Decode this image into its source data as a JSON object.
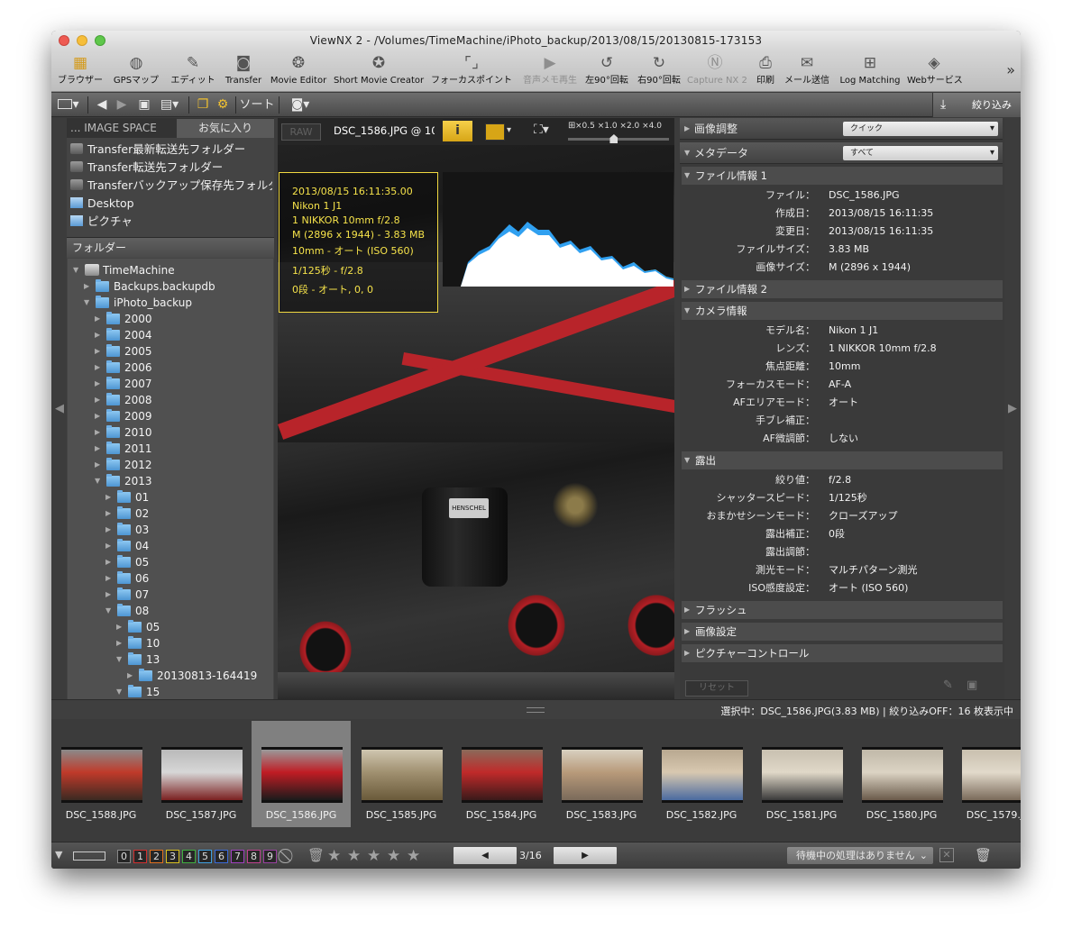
{
  "window": {
    "title": "ViewNX 2 - /Volumes/TimeMachine/iPhoto_backup/2013/08/15/20130815-173153"
  },
  "toolbar": {
    "items": [
      {
        "label": "ブラウザー",
        "icon": "browser-icon"
      },
      {
        "label": "GPSマップ",
        "icon": "globe-icon"
      },
      {
        "label": "エディット",
        "icon": "edit-icon"
      },
      {
        "label": "Transfer",
        "icon": "camera-icon"
      },
      {
        "label": "Movie Editor",
        "icon": "film-reel-icon"
      },
      {
        "label": "Short Movie Creator",
        "icon": "movie-creator-icon"
      },
      {
        "label": "フォーカスポイント",
        "icon": "focus-point-icon"
      },
      {
        "label": "音声メモ再生",
        "icon": "play-icon"
      },
      {
        "label": "左90°回転",
        "icon": "rotate-left-icon"
      },
      {
        "label": "右90°回転",
        "icon": "rotate-right-icon"
      },
      {
        "label": "Capture NX 2",
        "icon": "capture-nx-icon"
      },
      {
        "label": "印刷",
        "icon": "print-icon"
      },
      {
        "label": "メール送信",
        "icon": "mail-icon"
      },
      {
        "label": "Log Matching",
        "icon": "log-matching-icon"
      },
      {
        "label": "Webサービス",
        "icon": "web-service-icon"
      }
    ],
    "more": "»"
  },
  "toolbar2": {
    "sort_label": "ソート",
    "filter_label": "絞り込み"
  },
  "left_panel": {
    "tab_image_space": "... IMAGE SPACE",
    "tab_favorites": "お気に入り",
    "favorites": [
      "Transfer最新転送先フォルダー",
      "Transfer転送先フォルダー",
      "Transferバックアップ保存先フォルダー",
      "Desktop",
      "ピクチャ"
    ],
    "folder_header": "フォルダー",
    "tree": [
      {
        "label": "TimeMachine",
        "level": 0,
        "open": true,
        "drive": true
      },
      {
        "label": "Backups.backupdb",
        "level": 1,
        "open": false
      },
      {
        "label": "iPhoto_backup",
        "level": 1,
        "open": true
      },
      {
        "label": "2000",
        "level": 2,
        "open": false
      },
      {
        "label": "2004",
        "level": 2,
        "open": false
      },
      {
        "label": "2005",
        "level": 2,
        "open": false
      },
      {
        "label": "2006",
        "level": 2,
        "open": false
      },
      {
        "label": "2007",
        "level": 2,
        "open": false
      },
      {
        "label": "2008",
        "level": 2,
        "open": false
      },
      {
        "label": "2009",
        "level": 2,
        "open": false
      },
      {
        "label": "2010",
        "level": 2,
        "open": false
      },
      {
        "label": "2011",
        "level": 2,
        "open": false
      },
      {
        "label": "2012",
        "level": 2,
        "open": false
      },
      {
        "label": "2013",
        "level": 2,
        "open": true
      },
      {
        "label": "01",
        "level": 3,
        "open": false
      },
      {
        "label": "02",
        "level": 3,
        "open": false
      },
      {
        "label": "03",
        "level": 3,
        "open": false
      },
      {
        "label": "04",
        "level": 3,
        "open": false
      },
      {
        "label": "05",
        "level": 3,
        "open": false
      },
      {
        "label": "06",
        "level": 3,
        "open": false
      },
      {
        "label": "07",
        "level": 3,
        "open": false
      },
      {
        "label": "08",
        "level": 3,
        "open": true
      },
      {
        "label": "05",
        "level": 4,
        "open": false
      },
      {
        "label": "10",
        "level": 4,
        "open": false
      },
      {
        "label": "13",
        "level": 4,
        "open": true
      },
      {
        "label": "20130813-164419",
        "level": 5,
        "open": false
      },
      {
        "label": "15",
        "level": 4,
        "open": true
      }
    ]
  },
  "viewer": {
    "raw_label": "RAW",
    "file_zoom": "DSC_1586.JPG @ 10",
    "info_label": "i",
    "zoom_options": "×0.5  ×1.0  ×2.0  ×4.0",
    "zoom_level": 0.45,
    "info_overlay": [
      "2013/08/15 16:11:35.00",
      "Nikon 1 J1",
      "1 NIKKOR 10mm f/2.8",
      "M (2896 x 1944) - 3.83 MB",
      "10mm - オート (ISO 560)",
      "1/125秒 - f/2.8",
      "0段 - オート, 0, 0"
    ],
    "photo_plate_text": "HENSCHEL"
  },
  "right_panel": {
    "adjust_label": "画像調整",
    "adjust_value": "クイック",
    "metadata_label": "メタデータ",
    "metadata_value": "すべて",
    "sections": [
      {
        "title": "ファイル情報 1",
        "open": true,
        "rows": [
          {
            "k": "ファイル：",
            "v": "DSC_1586.JPG"
          },
          {
            "k": "作成日：",
            "v": "2013/08/15 16:11:35"
          },
          {
            "k": "変更日：",
            "v": "2013/08/15 16:11:35"
          },
          {
            "k": "ファイルサイズ：",
            "v": "3.83 MB"
          },
          {
            "k": "画像サイズ：",
            "v": "M (2896 x 1944)"
          }
        ]
      },
      {
        "title": "ファイル情報 2",
        "open": false,
        "rows": []
      },
      {
        "title": "カメラ情報",
        "open": true,
        "rows": [
          {
            "k": "モデル名：",
            "v": "Nikon 1 J1"
          },
          {
            "k": "レンズ：",
            "v": "1 NIKKOR 10mm f/2.8"
          },
          {
            "k": "焦点距離：",
            "v": "10mm"
          },
          {
            "k": "フォーカスモード：",
            "v": "AF-A"
          },
          {
            "k": "AFエリアモード：",
            "v": "オート"
          },
          {
            "k": "手ブレ補正：",
            "v": ""
          },
          {
            "k": "AF微調節：",
            "v": "しない"
          }
        ]
      },
      {
        "title": "露出",
        "open": true,
        "rows": [
          {
            "k": "絞り値：",
            "v": "f/2.8"
          },
          {
            "k": "シャッタースピード：",
            "v": "1/125秒"
          },
          {
            "k": "おまかせシーンモード：",
            "v": "クローズアップ"
          },
          {
            "k": "露出補正：",
            "v": "0段"
          },
          {
            "k": "露出調節：",
            "v": ""
          },
          {
            "k": "測光モード：",
            "v": "マルチパターン測光"
          },
          {
            "k": "ISO感度設定：",
            "v": "オート (ISO 560)"
          }
        ]
      },
      {
        "title": "フラッシュ",
        "open": false,
        "rows": []
      },
      {
        "title": "画像設定",
        "open": false,
        "rows": []
      },
      {
        "title": "ピクチャーコントロール",
        "open": false,
        "rows": []
      }
    ],
    "reset_label": "リセット"
  },
  "status": {
    "text": "選択中：DSC_1586.JPG(3.83 MB) | 絞り込みOFF：16 枚表示中"
  },
  "filmstrip": {
    "thumbs": [
      {
        "name": "DSC_1588.JPG",
        "c1": "#8a8a8a",
        "c2": "#3b2a22",
        "c3": "#c03a2a"
      },
      {
        "name": "DSC_1587.JPG",
        "c1": "#b9b9b9",
        "c2": "#7a2020",
        "c3": "#d7d7d7"
      },
      {
        "name": "DSC_1586.JPG",
        "c1": "#9a9a9a",
        "c2": "#1b1b1b",
        "c3": "#c01c24",
        "selected": true
      },
      {
        "name": "DSC_1585.JPG",
        "c1": "#cfc6b0",
        "c2": "#6a5a3a",
        "c3": "#a09070"
      },
      {
        "name": "DSC_1584.JPG",
        "c1": "#8a6a5a",
        "c2": "#3a1a1a",
        "c3": "#c02a2a"
      },
      {
        "name": "DSC_1583.JPG",
        "c1": "#d8d0c0",
        "c2": "#7a6a5a",
        "c3": "#b89a7a"
      },
      {
        "name": "DSC_1582.JPG",
        "c1": "#b8a890",
        "c2": "#4a6aa0",
        "c3": "#d8c8b0"
      },
      {
        "name": "DSC_1581.JPG",
        "c1": "#c8c0b0",
        "c2": "#3a3a3a",
        "c3": "#e0d8c8"
      },
      {
        "name": "DSC_1580.JPG",
        "c1": "#c0b8a8",
        "c2": "#6a5a4a",
        "c3": "#dcd4c4"
      },
      {
        "name": "DSC_1579.JPG",
        "c1": "#c8bfae",
        "c2": "#7a6a5a",
        "c3": "#e2dacb"
      }
    ]
  },
  "bottombar": {
    "labels": [
      "0",
      "1",
      "2",
      "3",
      "4",
      "5",
      "6",
      "7",
      "8",
      "9"
    ],
    "label_colors": [
      "#888888",
      "#d03030",
      "#e07020",
      "#d8c020",
      "#40b040",
      "#40a0e0",
      "#3a6ad8",
      "#a040c0",
      "#c04090",
      "#9a40a0"
    ],
    "stars": [
      "★",
      "★",
      "★",
      "★",
      "★"
    ],
    "page_indicator": "3/16",
    "queue_text": "待機中の処理はありません"
  },
  "colors": {
    "accent_yellow": "#f5e24a",
    "selection": "#808080",
    "stripe_red": "#b8242a"
  }
}
